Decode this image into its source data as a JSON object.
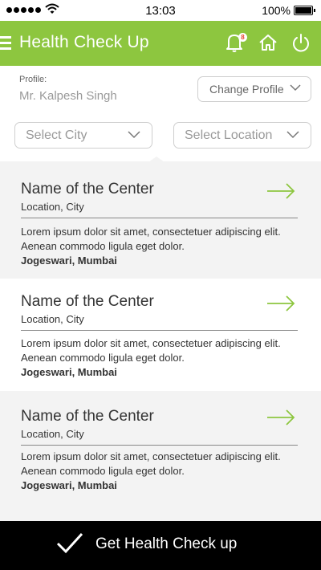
{
  "status_bar": {
    "time": "13:03",
    "battery": "100%"
  },
  "header": {
    "title": "Health Check Up",
    "notification_count": "8"
  },
  "profile": {
    "label": "Profile:",
    "name": "Mr. Kalpesh Singh",
    "change_button": "Change Profile"
  },
  "filters": {
    "city_placeholder": "Select City",
    "location_placeholder": "Select Location"
  },
  "centers": [
    {
      "name": "Name of the Center",
      "location": "Location, City",
      "description": "Lorem ipsum dolor sit amet, consectetuer adipiscing elit. Aenean commodo ligula eget dolor.",
      "area": "Jogeswari, Mumbai"
    },
    {
      "name": "Name of the Center",
      "location": "Location, City",
      "description": "Lorem ipsum dolor sit amet, consectetuer adipiscing elit. Aenean commodo ligula eget dolor.",
      "area": "Jogeswari, Mumbai"
    },
    {
      "name": "Name of the Center",
      "location": "Location, City",
      "description": "Lorem ipsum dolor sit amet, consectetuer adipiscing elit. Aenean commodo ligula eget dolor.",
      "area": "Jogeswari, Mumbai"
    }
  ],
  "bottom_action": {
    "label": "Get Health Check up"
  },
  "colors": {
    "accent": "#8dc63f",
    "list_background": "#f3f3f3",
    "bottom_bar": "#000000",
    "badge_text": "#e8412b"
  },
  "icons": [
    "signal-icon",
    "wifi-icon",
    "battery-icon",
    "menu-icon",
    "bell-icon",
    "home-icon",
    "power-icon",
    "chevron-down-icon",
    "arrow-right-icon",
    "checkmark-icon"
  ]
}
